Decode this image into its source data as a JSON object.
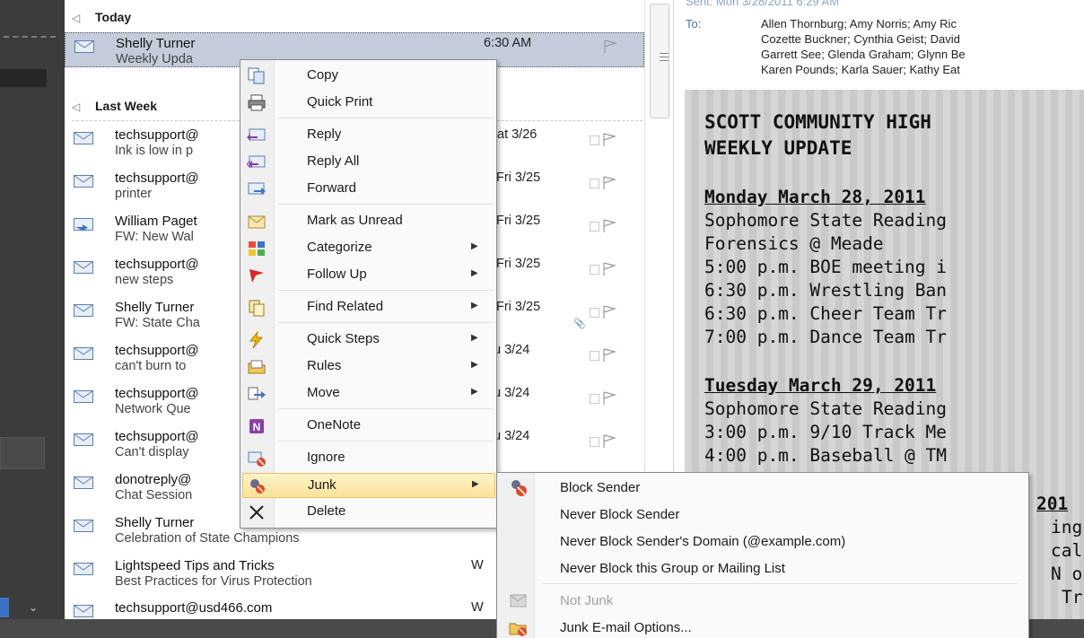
{
  "mail_list": {
    "groups": [
      {
        "label": "Today"
      },
      {
        "label": "Last Week"
      }
    ],
    "items": [
      {
        "sender": "Shelly Turner",
        "subject": "Weekly Upda",
        "date": "6:30 AM"
      },
      {
        "sender": "techsupport@",
        "subject": "Ink is low in p",
        "date": "at 3/26"
      },
      {
        "sender": "techsupport@",
        "subject": "printer",
        "date": "Fri 3/25"
      },
      {
        "sender": "William Paget",
        "subject": "FW: New Wal",
        "date": "Fri 3/25"
      },
      {
        "sender": "techsupport@",
        "subject": "new steps",
        "date": "Fri 3/25"
      },
      {
        "sender": "Shelly Turner",
        "subject": "FW: State Cha",
        "date": "Fri 3/25"
      },
      {
        "sender": "techsupport@",
        "subject": "can't burn to",
        "date": "u 3/24"
      },
      {
        "sender": "techsupport@",
        "subject": "Network Que",
        "date": "u 3/24"
      },
      {
        "sender": "techsupport@",
        "subject": "Can't display",
        "date": "u 3/24"
      },
      {
        "sender": "donotreply@",
        "subject": "Chat Session",
        "date": ""
      },
      {
        "sender": "Shelly Turner",
        "subject": "Celebration of State Champions",
        "date": ""
      },
      {
        "sender": "Lightspeed Tips and Tricks",
        "subject": "Best Practices for Virus Protection",
        "date": "W"
      },
      {
        "sender": "techsupport@usd466.com",
        "subject": "",
        "date": "W"
      }
    ]
  },
  "reading_pane": {
    "sent_line": "Sent:   Mon 3/28/2011 6:29 AM",
    "to_label": "To:",
    "to_lines": [
      "Allen Thornburg; Amy Norris; Amy Ric",
      "Cozette Buckner; Cynthia Geist; David",
      "Garrett See; Glenda Graham; Glynn Be",
      "Karen Pounds; Karla Sauer; Kathy Eat"
    ],
    "body": {
      "title_1": "SCOTT COMMUNITY HIGH",
      "title_2": "WEEKLY UPDATE",
      "day_1": "Monday March 28, 2011",
      "day_1_lines": [
        "Sophomore State Reading",
        "Forensics @ Meade",
        "5:00 p.m. BOE meeting i",
        "6:30 p.m. Wrestling Ban",
        "6:30 p.m. Cheer Team Tr",
        "7:00 p.m. Dance Team Tr"
      ],
      "day_2": "Tuesday March 29, 2011",
      "day_2_lines": [
        "Sophomore State Reading",
        "3:00 p.m. 9/10 Track Me",
        "4:00 p.m. Baseball @ TM"
      ],
      "partial_lines": [
        "201",
        "ing",
        "cal",
        "N o",
        "Tr"
      ]
    }
  },
  "context_menu": {
    "items": [
      {
        "label": "Copy",
        "icon": "copy-icon"
      },
      {
        "label": "Quick Print",
        "icon": "print-icon"
      },
      {
        "label": "Reply",
        "icon": "reply-icon"
      },
      {
        "label": "Reply All",
        "icon": "reply-all-icon"
      },
      {
        "label": "Forward",
        "icon": "forward-icon"
      },
      {
        "label": "Mark as Unread",
        "icon": "mark-unread-icon"
      },
      {
        "label": "Categorize",
        "icon": "categorize-icon"
      },
      {
        "label": "Follow Up",
        "icon": "follow-up-flag-icon"
      },
      {
        "label": "Find Related",
        "icon": "find-related-icon"
      },
      {
        "label": "Quick Steps",
        "icon": "quick-steps-icon"
      },
      {
        "label": "Rules",
        "icon": "rules-icon"
      },
      {
        "label": "Move",
        "icon": "move-icon"
      },
      {
        "label": "OneNote",
        "icon": "onenote-icon"
      },
      {
        "label": "Ignore",
        "icon": "ignore-icon"
      },
      {
        "label": "Junk",
        "icon": "junk-icon"
      },
      {
        "label": "Delete",
        "icon": "delete-icon"
      }
    ]
  },
  "junk_submenu": {
    "items": [
      {
        "label": "Block Sender",
        "icon": "block-sender-icon"
      },
      {
        "label": "Never Block Sender"
      },
      {
        "label": "Never Block Sender's Domain (@example.com)"
      },
      {
        "label": "Never Block this Group or Mailing List"
      },
      {
        "label": "Not Junk",
        "icon": "not-junk-icon"
      },
      {
        "label": "Junk E-mail Options...",
        "icon": "junk-options-icon"
      }
    ]
  },
  "colors": {
    "selected_row": "#c4ccdb",
    "menu_highlight": "#fbe29a",
    "link_blue": "#4a73b1"
  }
}
